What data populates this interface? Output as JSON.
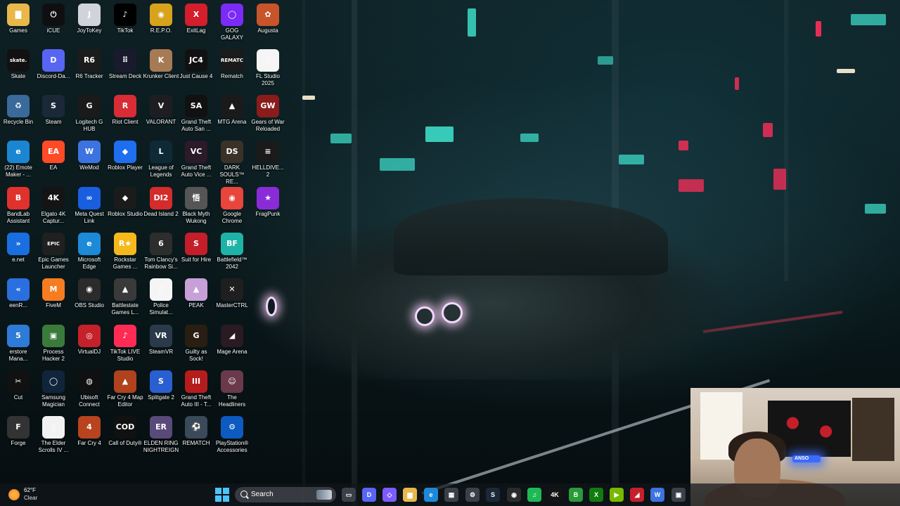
{
  "desktop_icons": [
    {
      "label": "Games",
      "glyph": "▇",
      "color": "#e8b84a"
    },
    {
      "label": "Skate",
      "glyph": "skate.",
      "color": "#111111"
    },
    {
      "label": "Recycle Bin",
      "glyph": "♻",
      "color": "#3a6a9a"
    },
    {
      "label": "(22) Emote Maker - ...",
      "glyph": "e",
      "color": "#1a86d1"
    },
    {
      "label": "BandLab Assistant",
      "glyph": "B",
      "color": "#e0322c"
    },
    {
      "label": "e.net",
      "glyph": "»",
      "color": "#1a6fe0"
    },
    {
      "label": "eenR...",
      "glyph": "«",
      "color": "#2a6fe0"
    },
    {
      "label": "erstore Mana...",
      "glyph": "5",
      "color": "#2d7bd6"
    },
    {
      "label": "Cut",
      "glyph": "✂",
      "color": "#111111"
    },
    {
      "label": "Forge",
      "glyph": "F",
      "color": "#333333"
    },
    {
      "label": "iCUE",
      "glyph": "⏻",
      "color": "#0f0f12"
    },
    {
      "label": "Discord-Da...",
      "glyph": "D",
      "color": "#5865f2"
    },
    {
      "label": "Steam",
      "glyph": "S",
      "color": "#1b2838"
    },
    {
      "label": "EA",
      "glyph": "EA",
      "color": "#ff4a27"
    },
    {
      "label": "Elgato 4K Captur...",
      "glyph": "4K",
      "color": "#141414"
    },
    {
      "label": "Epic Games Launcher",
      "glyph": "EPIC",
      "color": "#202020"
    },
    {
      "label": "FiveM",
      "glyph": "M",
      "color": "#f57c1f"
    },
    {
      "label": "Process Hacker 2",
      "glyph": "▣",
      "color": "#3a7a3a"
    },
    {
      "label": "Samsung Magician",
      "glyph": "◯",
      "color": "#10243a"
    },
    {
      "label": "The Elder Scrolls IV ...",
      "glyph": "▯",
      "color": "#f2f2f2"
    },
    {
      "label": "JoyToKey",
      "glyph": "J",
      "color": "#d0d4da"
    },
    {
      "label": "R6 Tracker",
      "glyph": "R6",
      "color": "#1c1c1c"
    },
    {
      "label": "Logitech G HUB",
      "glyph": "G",
      "color": "#1a1a1a"
    },
    {
      "label": "WeMod",
      "glyph": "W",
      "color": "#3c73e0"
    },
    {
      "label": "Meta Quest Link",
      "glyph": "∞",
      "color": "#1a5ee0"
    },
    {
      "label": "Microsoft Edge",
      "glyph": "e",
      "color": "#1c8ad8"
    },
    {
      "label": "OBS Studio",
      "glyph": "◉",
      "color": "#2b2b2b"
    },
    {
      "label": "VirtualDJ",
      "glyph": "◎",
      "color": "#c4212b"
    },
    {
      "label": "Ubisoft Connect",
      "glyph": "◍",
      "color": "#101010"
    },
    {
      "label": "Far Cry 4",
      "glyph": "4",
      "color": "#b8431e"
    },
    {
      "label": "TikTok",
      "glyph": "♪",
      "color": "#000000"
    },
    {
      "label": "Stream Deck",
      "glyph": "⠿",
      "color": "#1a1a2e"
    },
    {
      "label": "Riot Client",
      "glyph": "R",
      "color": "#d92c35"
    },
    {
      "label": "Roblox Player",
      "glyph": "◆",
      "color": "#1f6ef0"
    },
    {
      "label": "Roblox Studio",
      "glyph": "◆",
      "color": "#1b1b1b"
    },
    {
      "label": "Rockstar Games ...",
      "glyph": "R★",
      "color": "#f5b91b"
    },
    {
      "label": "Battlestate Games L...",
      "glyph": "▲",
      "color": "#3a3a3a"
    },
    {
      "label": "TikTok LIVE Studio",
      "glyph": "♪",
      "color": "#fe2c55"
    },
    {
      "label": "Far Cry 4 Map Editor",
      "glyph": "▲",
      "color": "#b0421d"
    },
    {
      "label": "Call of Duty®",
      "glyph": "COD",
      "color": "#111111"
    },
    {
      "label": "R.E.P.O.",
      "glyph": "◉",
      "color": "#d7a21c"
    },
    {
      "label": "Krunker Client",
      "glyph": "K",
      "color": "#a77a56"
    },
    {
      "label": "VALORANT",
      "glyph": "V",
      "color": "#1e1e22"
    },
    {
      "label": "League of Legends",
      "glyph": "L",
      "color": "#0e2a37"
    },
    {
      "label": "Dead Island 2",
      "glyph": "DI2",
      "color": "#d42b2b"
    },
    {
      "label": "Tom Clancy's Rainbow Si...",
      "glyph": "6",
      "color": "#2d2d2d"
    },
    {
      "label": "Police Simulat...",
      "glyph": "▯",
      "color": "#f5f5f5"
    },
    {
      "label": "SteamVR",
      "glyph": "VR",
      "color": "#2a3a4a"
    },
    {
      "label": "Splitgate 2",
      "glyph": "S",
      "color": "#2a5fd0"
    },
    {
      "label": "ELDEN RING NIGHTREIGN",
      "glyph": "ER",
      "color": "#5a4a7a"
    },
    {
      "label": "ExitLag",
      "glyph": "X",
      "color": "#d41e2b"
    },
    {
      "label": "Just Cause 4",
      "glyph": "JC4",
      "color": "#111111"
    },
    {
      "label": "Grand Theft Auto San ...",
      "glyph": "SA",
      "color": "#111111"
    },
    {
      "label": "Grand Theft Auto Vice ...",
      "glyph": "VC",
      "color": "#2a1a2a"
    },
    {
      "label": "Black Myth Wukong",
      "glyph": "悟",
      "color": "#555555"
    },
    {
      "label": "Suit for Hire",
      "glyph": "S",
      "color": "#c31e2a"
    },
    {
      "label": "PEAK",
      "glyph": "▲",
      "color": "#c8a0d8"
    },
    {
      "label": "Guilty as Sock!",
      "glyph": "G",
      "color": "#2a1e12"
    },
    {
      "label": "Grand Theft Auto III - T...",
      "glyph": "III",
      "color": "#b71c1c"
    },
    {
      "label": "REMATCH",
      "glyph": "⚽",
      "color": "#3a4a5a"
    },
    {
      "label": "GOG GALAXY",
      "glyph": "◯",
      "color": "#7b2bf7"
    },
    {
      "label": "Rematch",
      "glyph": "REMATCH",
      "color": "#1a1a1a"
    },
    {
      "label": "MTG Arena",
      "glyph": "▲",
      "color": "#1a1a1a"
    },
    {
      "label": "DARK SOULS™ RE...",
      "glyph": "DS",
      "color": "#3a3228"
    },
    {
      "label": "Google Chrome",
      "glyph": "◉",
      "color": "#e8453c"
    },
    {
      "label": "Battlefield™ 2042",
      "glyph": "BF",
      "color": "#1fb3a8"
    },
    {
      "label": "MasterCTRL",
      "glyph": "✕",
      "color": "#1f1f1f"
    },
    {
      "label": "Mage Arena",
      "glyph": "◢",
      "color": "#2a1a22"
    },
    {
      "label": "The Headliners",
      "glyph": "☺",
      "color": "#6a3a4a"
    },
    {
      "label": "PlayStation® Accessories",
      "glyph": "⚙",
      "color": "#0d5ac0"
    },
    {
      "label": "Augusta",
      "glyph": "✿",
      "color": "#c8542a"
    },
    {
      "label": "FL Studio 2025",
      "glyph": "▯",
      "color": "#f5f5f5"
    },
    {
      "label": "Gears of War Reloaded",
      "glyph": "GW",
      "color": "#8a1c1c"
    },
    {
      "label": "HELLDIVE... 2",
      "glyph": "≡",
      "color": "#1a1a1a"
    },
    {
      "label": "FragPunk",
      "glyph": "★",
      "color": "#8a2bd8"
    }
  ],
  "taskbar": {
    "weather_temp": "62°F",
    "weather_desc": "Clear",
    "search_label": "Search",
    "apps": [
      {
        "name": "task-view",
        "glyph": "▭",
        "color": "#3a3f48"
      },
      {
        "name": "discord",
        "glyph": "D",
        "color": "#5865f2"
      },
      {
        "name": "copilot",
        "glyph": "◇",
        "color": "#7b5cff"
      },
      {
        "name": "file-explorer",
        "glyph": "▆",
        "color": "#e8b84a"
      },
      {
        "name": "edge",
        "glyph": "e",
        "color": "#1c8ad8"
      },
      {
        "name": "store",
        "glyph": "▦",
        "color": "#3a3f48"
      },
      {
        "name": "settings",
        "glyph": "⚙",
        "color": "#3a3f48"
      },
      {
        "name": "steam",
        "glyph": "S",
        "color": "#1b2838"
      },
      {
        "name": "obs",
        "glyph": "◉",
        "color": "#2b2b2b"
      },
      {
        "name": "spotify",
        "glyph": "♫",
        "color": "#1db954"
      },
      {
        "name": "elgato",
        "glyph": "4K",
        "color": "#141414"
      },
      {
        "name": "bandlab",
        "glyph": "B",
        "color": "#2a9a3a"
      },
      {
        "name": "xbox",
        "glyph": "X",
        "color": "#107c10"
      },
      {
        "name": "nvidia",
        "glyph": "▶",
        "color": "#76b900"
      },
      {
        "name": "msi",
        "glyph": "◢",
        "color": "#c4212b"
      },
      {
        "name": "wemod",
        "glyph": "W",
        "color": "#3c73e0"
      },
      {
        "name": "sandbox",
        "glyph": "▣",
        "color": "#3a3f48"
      }
    ]
  },
  "webcam": {
    "neon_sign": "ANSO"
  }
}
